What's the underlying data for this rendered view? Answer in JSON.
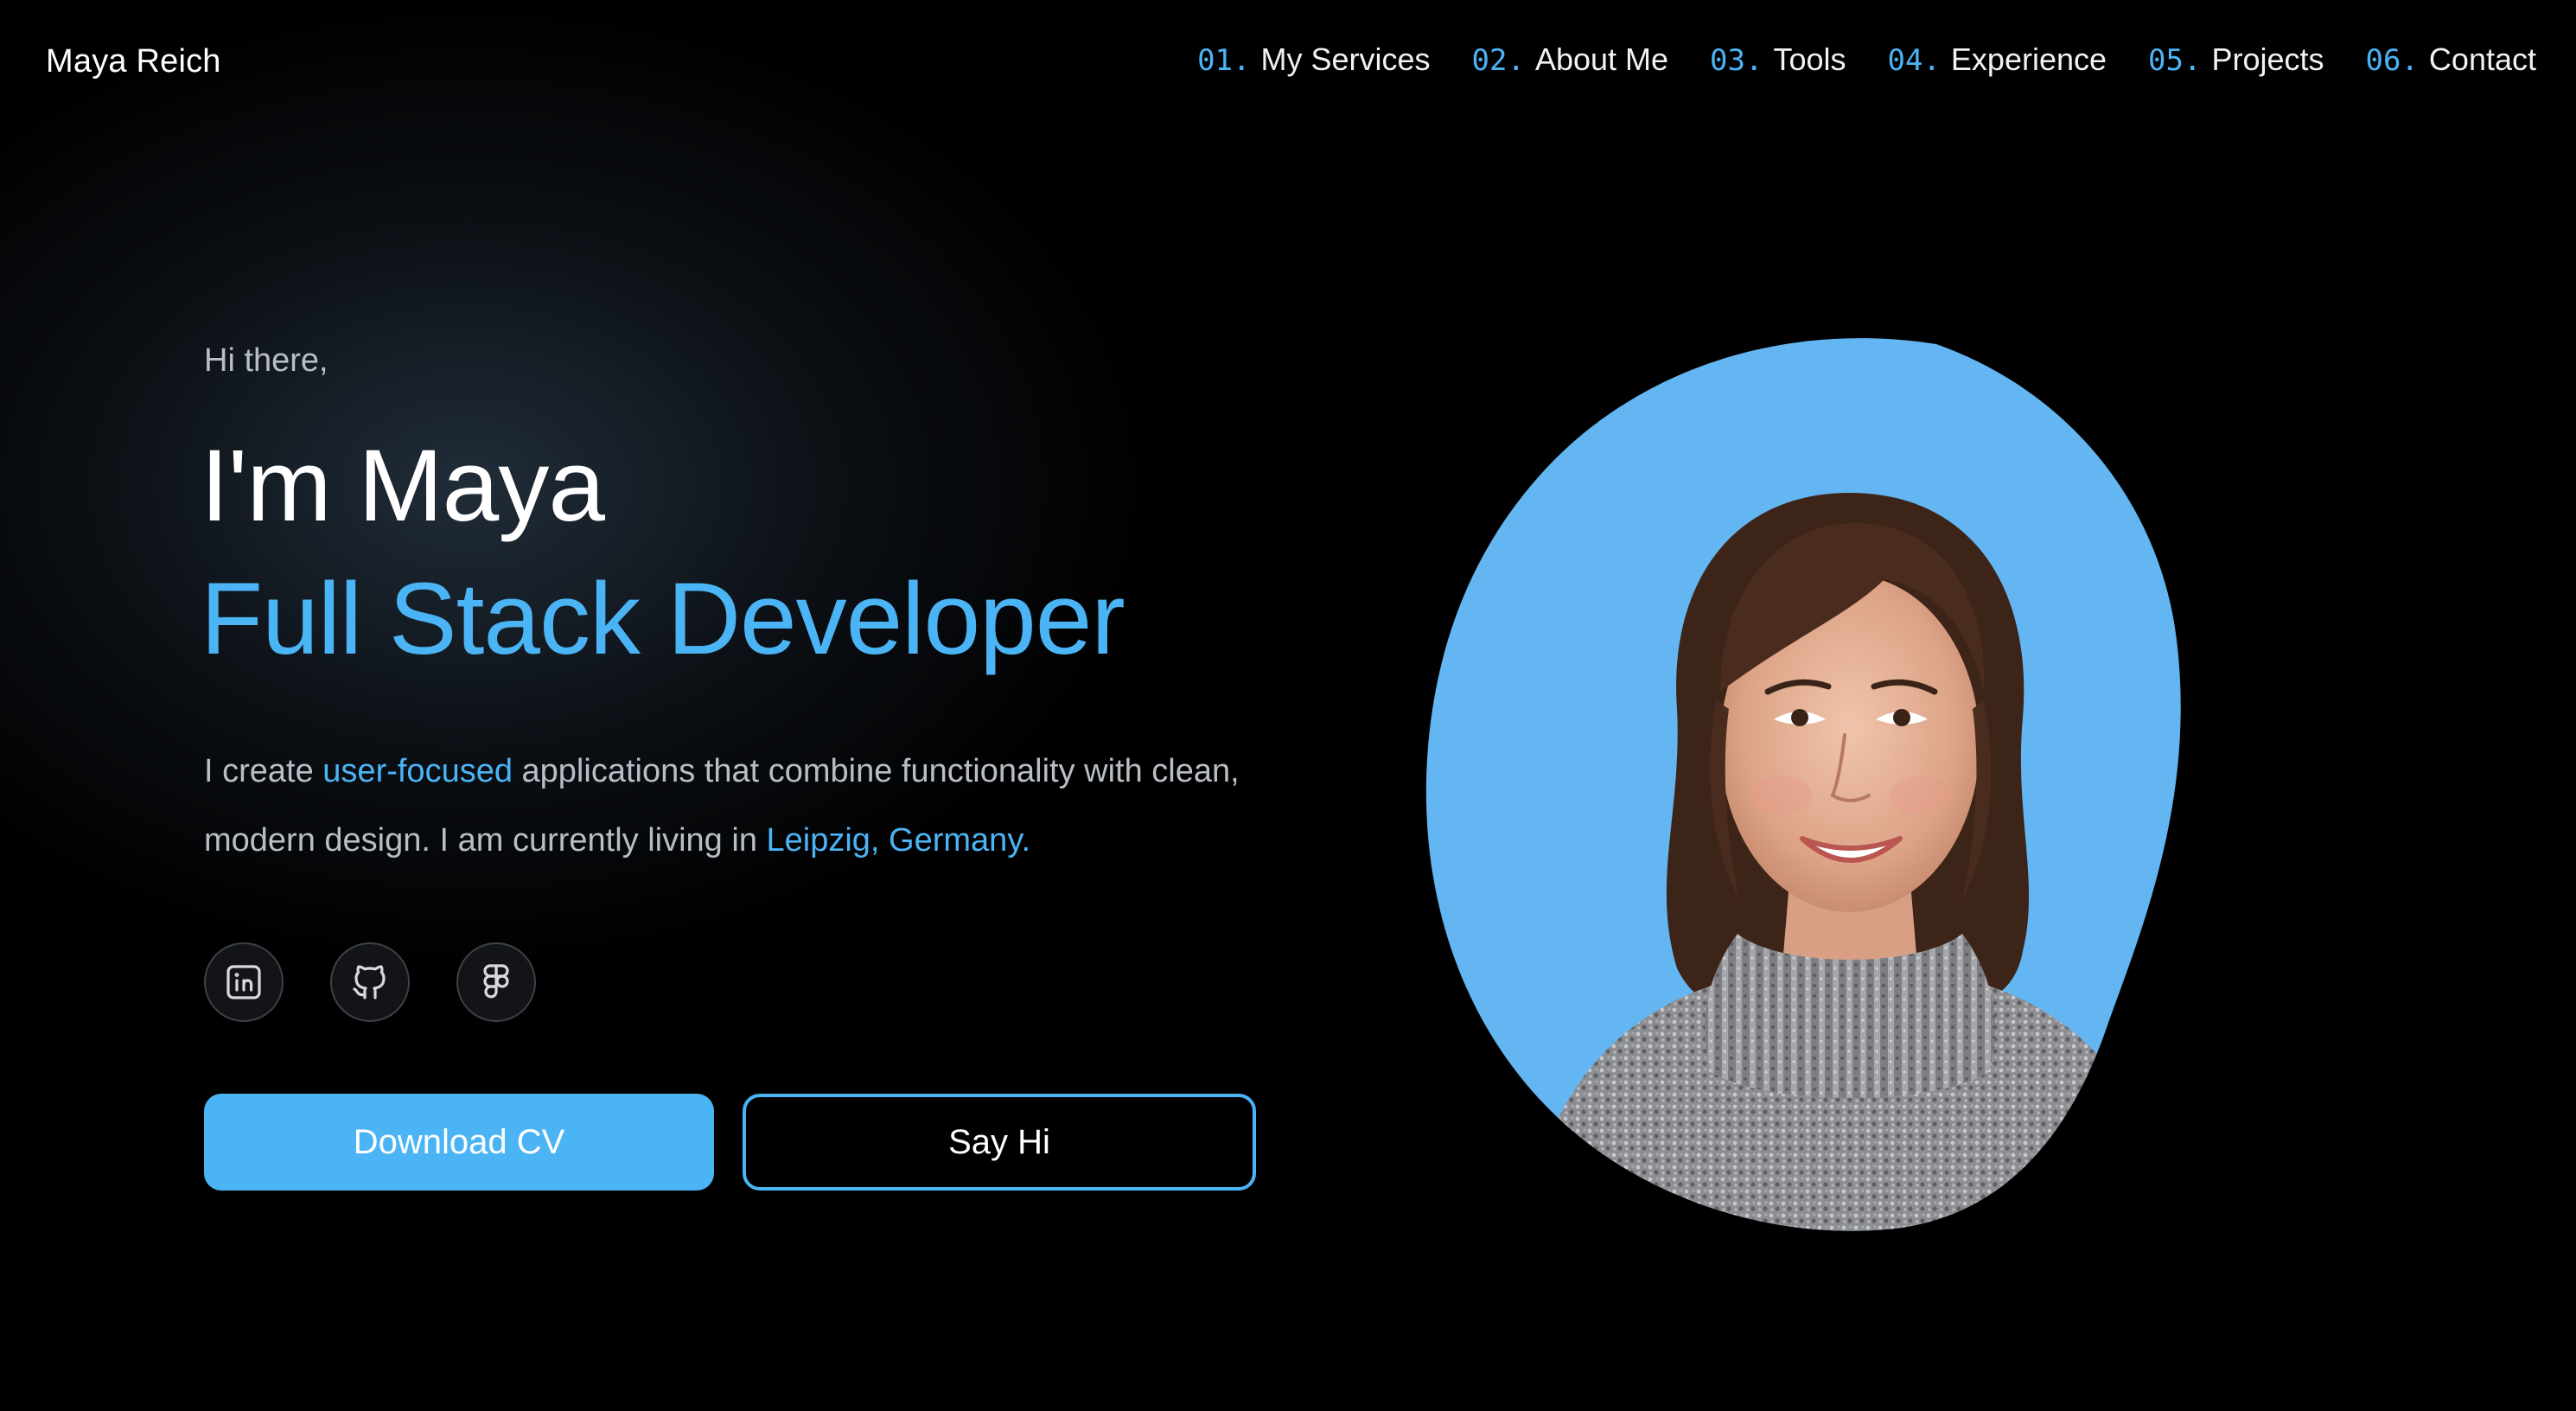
{
  "header": {
    "brand": "Maya Reich",
    "nav": [
      {
        "num": "01.",
        "label": "My Services"
      },
      {
        "num": "02.",
        "label": "About Me"
      },
      {
        "num": "03.",
        "label": "Tools"
      },
      {
        "num": "04.",
        "label": "Experience"
      },
      {
        "num": "05.",
        "label": "Projects"
      },
      {
        "num": "06.",
        "label": "Contact"
      }
    ]
  },
  "hero": {
    "greeting": "Hi there,",
    "headline": "I'm Maya",
    "role": "Full Stack Developer",
    "intro": {
      "part1": "I create ",
      "highlight1": "user-focused",
      "part2": " applications that combine functionality with clean, modern design. I am currently living in ",
      "highlight2": "Leipzig, Germany."
    },
    "socials": [
      {
        "icon": "linkedin-icon"
      },
      {
        "icon": "github-icon"
      },
      {
        "icon": "figma-icon"
      }
    ],
    "buttons": {
      "primary": "Download CV",
      "secondary": "Say Hi"
    }
  },
  "colors": {
    "background": "#000000",
    "accent": "#4bb4f5",
    "text": "#ffffff",
    "muted": "#b9bec6"
  }
}
